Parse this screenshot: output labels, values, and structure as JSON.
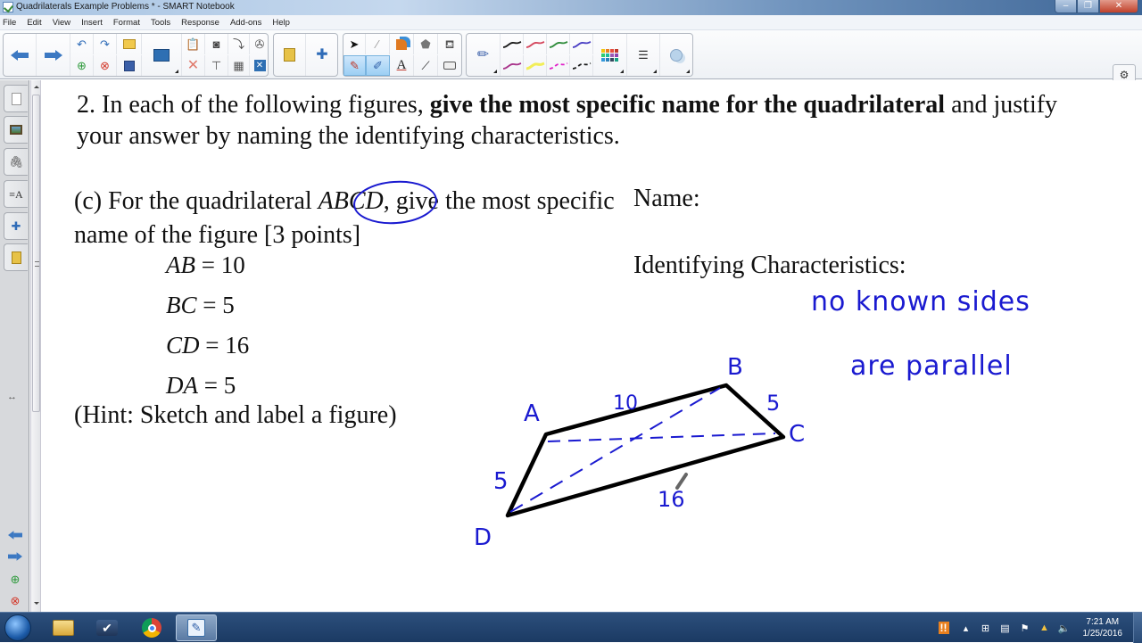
{
  "window": {
    "title": "Quadrilaterals Example Problems * - SMART Notebook",
    "controls": {
      "minimize": "–",
      "maximize": "❐",
      "close": "✕"
    }
  },
  "menu": [
    "File",
    "Edit",
    "View",
    "Insert",
    "Format",
    "Tools",
    "Response",
    "Add-ons",
    "Help"
  ],
  "toolbar": {
    "nav": [
      "previous-page",
      "next-page"
    ],
    "edit": [
      "undo",
      "redo",
      "open-file",
      "add-page",
      "delete-page",
      "save",
      "display-screen",
      "paste",
      "screen-capture",
      "screen-shade",
      "measurement-tools",
      "delete",
      "document-camera",
      "insert-table",
      "full-screen"
    ],
    "addons": [
      "response",
      "addons-puzzle"
    ],
    "tools": [
      "select",
      "magic-pen",
      "shapes",
      "eraser-fill",
      "fill",
      "pens",
      "creative-pen",
      "text",
      "line",
      "eraser"
    ],
    "pen_colors": [
      "#1a1a1a",
      "#d4455c",
      "#2e8b3a",
      "#4a3fc4",
      "#a8338a",
      "#f2ee58",
      "#e020c8",
      "#1a1a1a"
    ],
    "properties": [
      "color-palette",
      "line-style",
      "transparency"
    ],
    "side": [
      "settings",
      "toolbar-position"
    ]
  },
  "sidebar": {
    "tabs": [
      "page-sorter",
      "gallery",
      "attachments",
      "properties",
      "addons",
      "response"
    ],
    "nav": [
      "previous",
      "next",
      "add-page",
      "delete-page"
    ],
    "resize": "↔"
  },
  "page": {
    "question_num": "2.",
    "question_pre": " In each of the following figures, ",
    "question_bold": "give the most specific name for the quadrilateral",
    "question_post": " and justify your answer by naming the identifying characteristics.",
    "part_label": "(c) For the quadrilateral ",
    "part_var": "ABCD",
    "part_rest": ", give the most specific name of the figure [3 points]",
    "equations": [
      {
        "lhs": "AB",
        "rhs": "10"
      },
      {
        "lhs": "BC",
        "rhs": "5"
      },
      {
        "lhs": "CD",
        "rhs": "16"
      },
      {
        "lhs": "DA",
        "rhs": "5"
      }
    ],
    "hint": "(Hint: Sketch and label a figure)",
    "name_label": "Name:",
    "ident_label": "Identifying Characteristics:"
  },
  "annotations": {
    "ink_color": "#1a1ad0",
    "answer_line1": "no known sides",
    "answer_line2": "are parallel",
    "vertices": {
      "A": "A",
      "B": "B",
      "C": "C",
      "D": "D"
    },
    "side_labels": {
      "AB": "10",
      "BC": "5",
      "CD": "16",
      "DA": "5"
    }
  },
  "taskbar": {
    "apps": [
      "windows-explorer",
      "task-app",
      "chrome",
      "smart-notebook"
    ],
    "clock_time": "7:21 AM",
    "clock_date": "1/25/2016"
  }
}
